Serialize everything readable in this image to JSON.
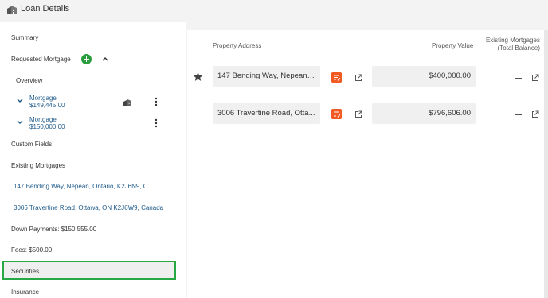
{
  "window": {
    "title": "Loan Details",
    "icon": "loan-details-icon"
  },
  "sidebar": {
    "summary": "Summary",
    "requested_mortgage": "Requested Mortgage",
    "overview": "Overview",
    "mortgages": [
      {
        "name": "Mortgage",
        "amount": "$149,445.00"
      },
      {
        "name": "Mortgage",
        "amount": "$150,000.00"
      }
    ],
    "custom_fields": "Custom Fields",
    "existing_mortgages": "Existing Mortgages",
    "properties": [
      "147 Bending Way, Nepean, Ontario, K2J6N9, C...",
      "3006 Travertine Road, Ottawa, ON K2J6W9, Canada"
    ],
    "down_payments": "Down Payments: $150,555.00",
    "fees": "Fees: $500.00",
    "securities": "Securities",
    "insurance": "Insurance"
  },
  "table": {
    "headers": {
      "address": "Property Address",
      "value": "Property Value",
      "existing_line1": "Existing Mortgages",
      "existing_line2": "(Total Balance)"
    },
    "rows": [
      {
        "address": "147 Bending Way, Nepean,...",
        "value": "$400,000.00",
        "existing": "—",
        "primary": true
      },
      {
        "address": "3006 Travertine Road, Otta...",
        "value": "$796,606.00",
        "existing": "—",
        "primary": false
      }
    ]
  },
  "colors": {
    "accent_green": "#2a9d3e",
    "link_blue": "#1e5a8a",
    "edit_orange": "#f15a22",
    "highlight_border": "#27a844"
  }
}
